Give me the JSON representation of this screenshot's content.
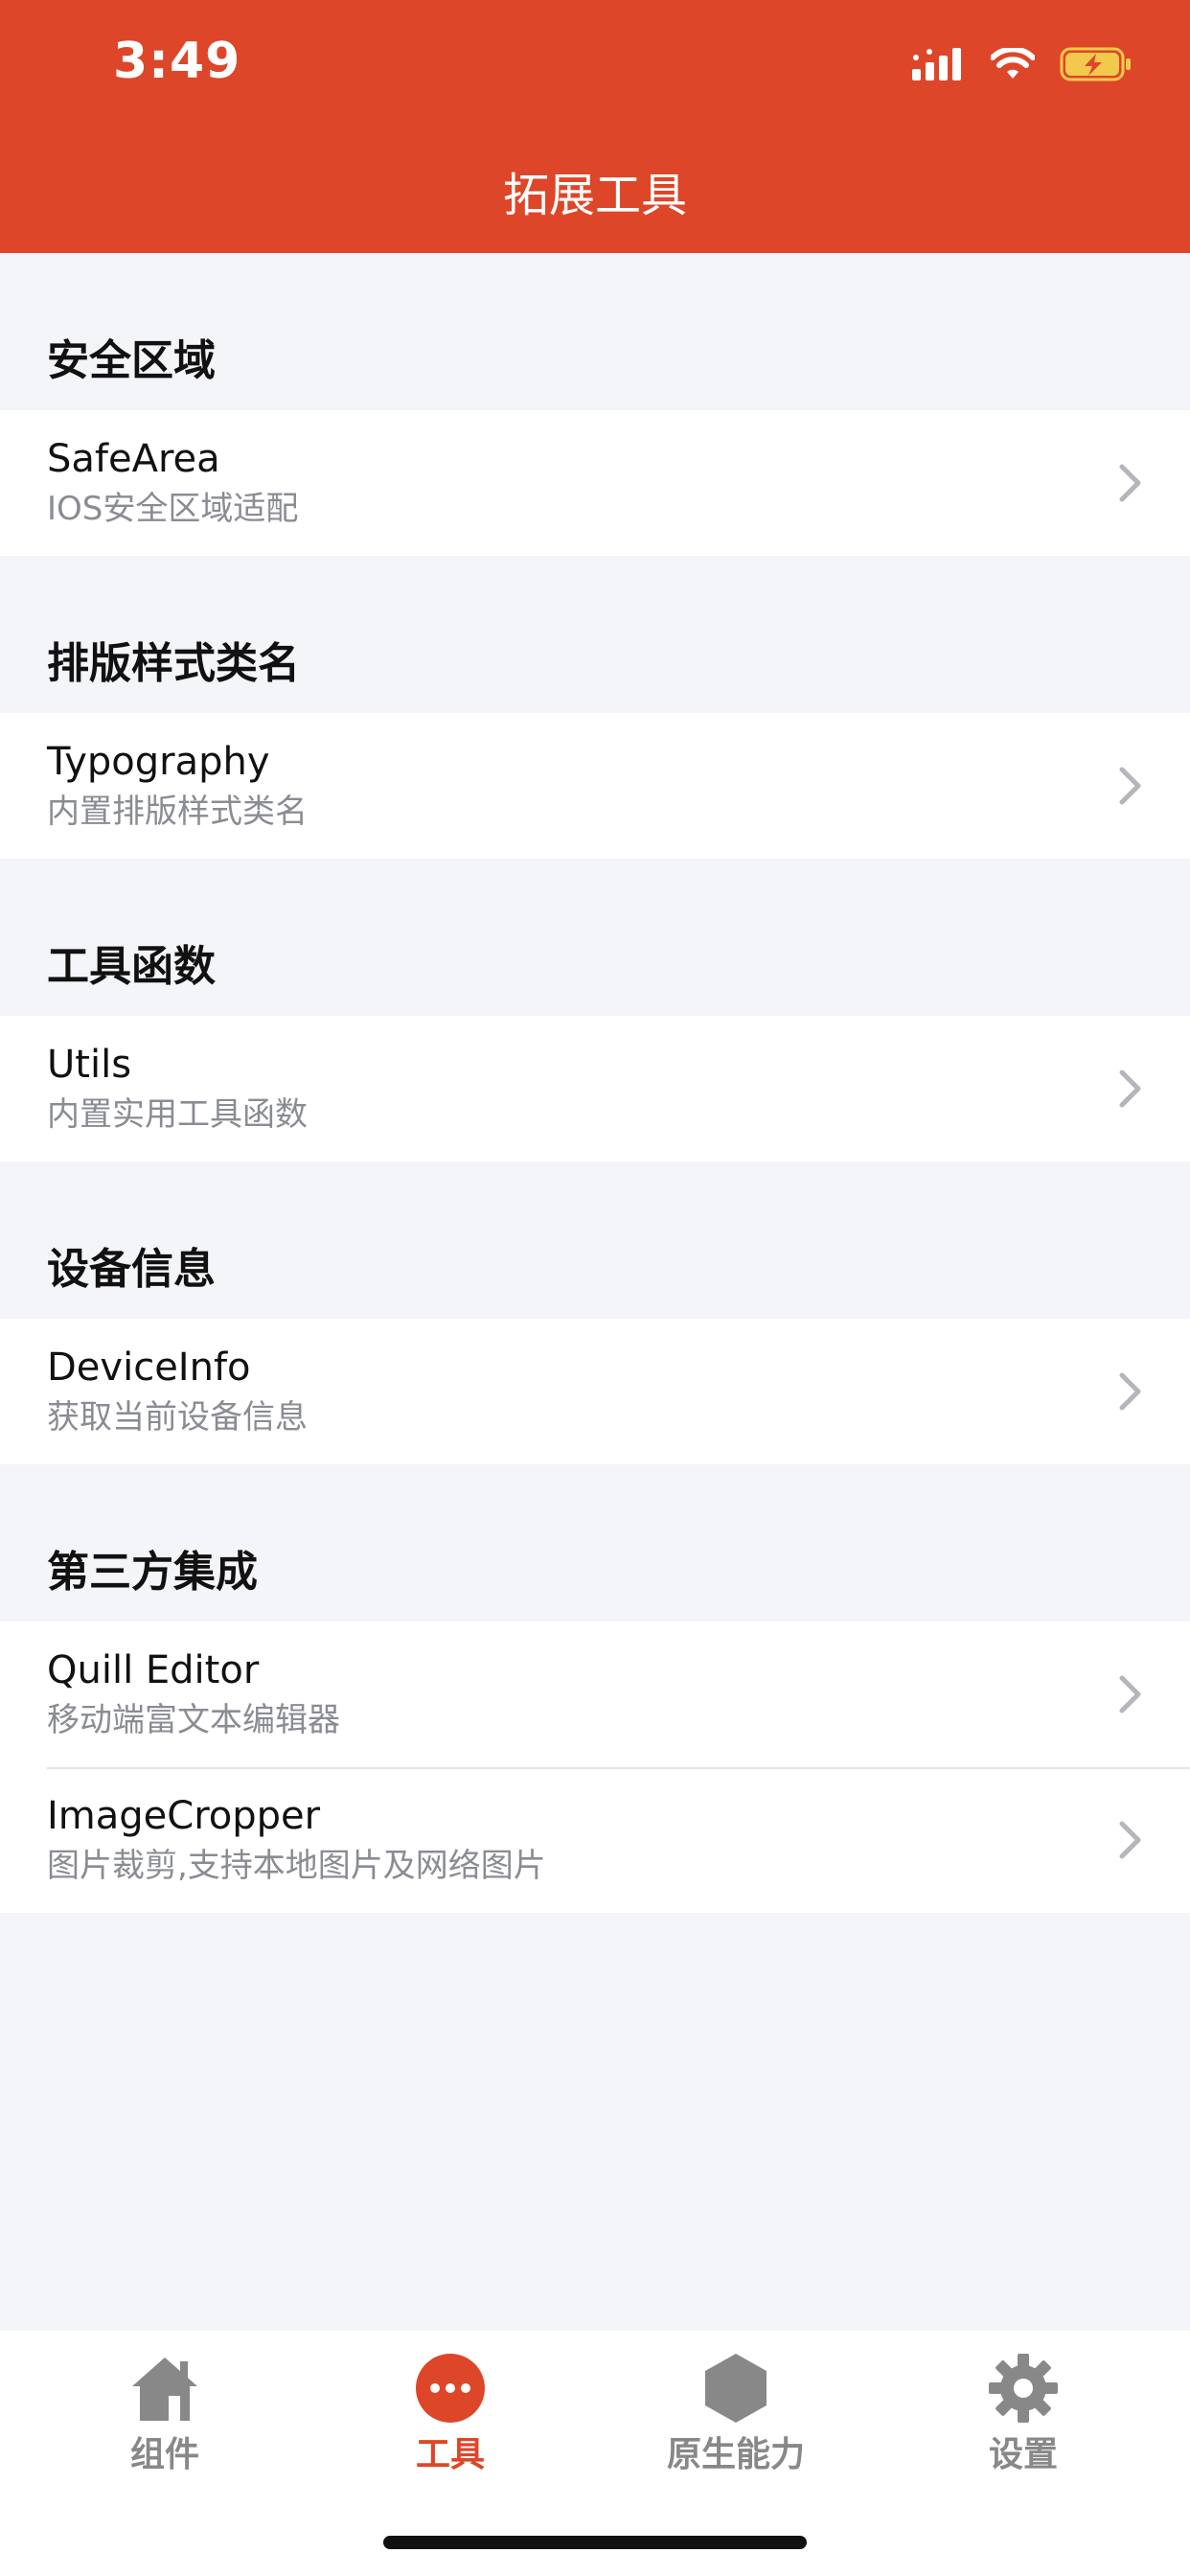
{
  "status": {
    "time": "3:49"
  },
  "nav": {
    "title": "拓展工具"
  },
  "sections": [
    {
      "title": "安全区域",
      "items": [
        {
          "title": "SafeArea",
          "subtitle": "IOS安全区域适配"
        }
      ]
    },
    {
      "title": "排版样式类名",
      "items": [
        {
          "title": "Typography",
          "subtitle": "内置排版样式类名"
        }
      ]
    },
    {
      "title": "工具函数",
      "items": [
        {
          "title": "Utils",
          "subtitle": "内置实用工具函数"
        }
      ]
    },
    {
      "title": "设备信息",
      "items": [
        {
          "title": "DeviceInfo",
          "subtitle": "获取当前设备信息"
        }
      ]
    },
    {
      "title": "第三方集成",
      "items": [
        {
          "title": "Quill Editor",
          "subtitle": "移动端富文本编辑器"
        },
        {
          "title": "ImageCropper",
          "subtitle": "图片裁剪,支持本地图片及网络图片"
        }
      ]
    }
  ],
  "tabbar": {
    "tabs": [
      {
        "label": "组件",
        "icon": "home-icon",
        "active": false
      },
      {
        "label": "工具",
        "icon": "more-icon",
        "active": true
      },
      {
        "label": "原生能力",
        "icon": "hexagon-icon",
        "active": false
      },
      {
        "label": "设置",
        "icon": "gear-icon",
        "active": false
      }
    ]
  },
  "colors": {
    "brand": "#dd4629",
    "background": "#f4f5f9",
    "inactive": "#888888"
  }
}
